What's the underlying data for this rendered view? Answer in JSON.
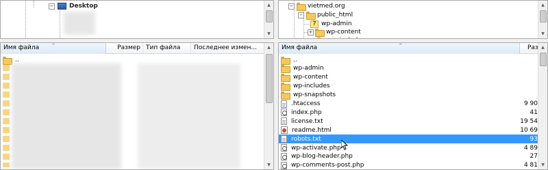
{
  "local_tree": {
    "nodes": [
      {
        "label": "Desktop",
        "icon": "desktop-icon",
        "expanded": true
      }
    ]
  },
  "remote_tree": {
    "nodes": [
      {
        "label": "vietmed.org",
        "icon": "folder-icon"
      },
      {
        "label": "public_html",
        "icon": "folder-icon"
      },
      {
        "label": "wp-admin",
        "icon": "unknown-folder-icon"
      },
      {
        "label": "wp-content",
        "icon": "folder-icon"
      },
      {
        "label": "wp-includes",
        "icon": "folder-icon"
      }
    ]
  },
  "local_list": {
    "columns": {
      "name": "Имя файла",
      "size": "Размер",
      "type": "Тип файла",
      "modified": "Последнее измен..."
    },
    "rows": [
      {
        "name": ".."
      }
    ]
  },
  "remote_list": {
    "columns": {
      "name": "Имя файла",
      "size": "Разме"
    },
    "rows": [
      {
        "name": "..",
        "size": "",
        "icon": "folder-icon"
      },
      {
        "name": "wp-admin",
        "size": "",
        "icon": "folder-icon"
      },
      {
        "name": "wp-content",
        "size": "",
        "icon": "folder-icon"
      },
      {
        "name": "wp-includes",
        "size": "",
        "icon": "folder-icon"
      },
      {
        "name": "wp-snapshots",
        "size": "",
        "icon": "folder-icon"
      },
      {
        "name": ".htaccess",
        "size": "9 90",
        "icon": "file-icon"
      },
      {
        "name": "index.php",
        "size": "41",
        "icon": "php-file-icon"
      },
      {
        "name": "license.txt",
        "size": "19 54",
        "icon": "file-icon"
      },
      {
        "name": "readme.html",
        "size": "10 69",
        "icon": "html-file-icon"
      },
      {
        "name": "robots.txt",
        "size": "93",
        "icon": "file-icon",
        "selected": true
      },
      {
        "name": "wp-activate.php",
        "size": "4 89",
        "icon": "php-file-icon"
      },
      {
        "name": "wp-blog-header.php",
        "size": "27",
        "icon": "php-file-icon"
      },
      {
        "name": "wp-comments-post.php",
        "size": "4 81",
        "icon": "php-file-icon"
      }
    ]
  },
  "colors": {
    "selection": "#3399ff",
    "sorted_header": "#dbeaf8",
    "folder": "#f3c95d"
  }
}
